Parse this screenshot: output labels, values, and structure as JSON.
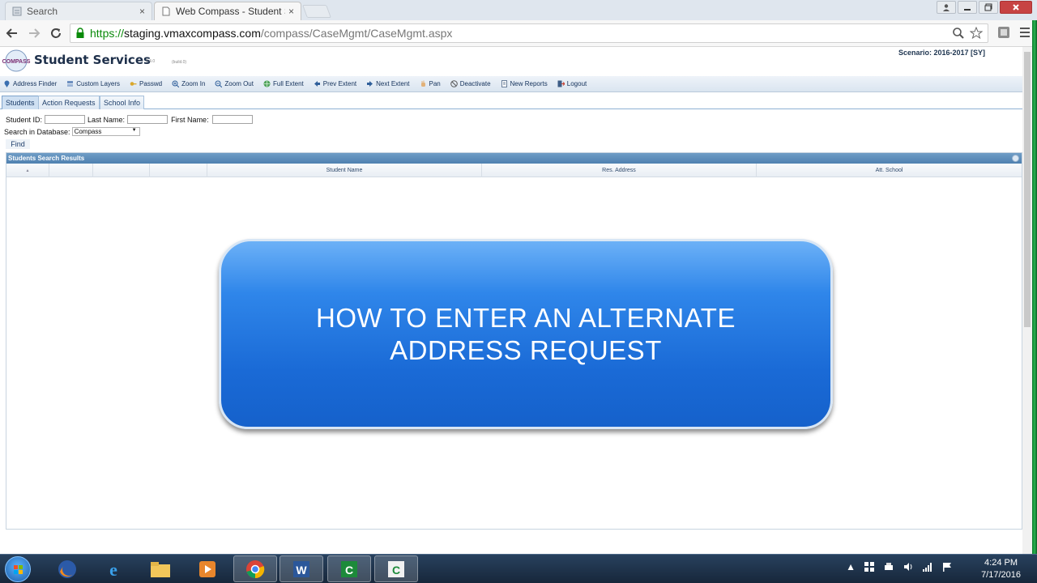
{
  "browser": {
    "tabs": [
      {
        "title": "Search",
        "close": "×"
      },
      {
        "title": "Web Compass - Student S",
        "close": "×"
      }
    ],
    "url": {
      "scheme": "https://",
      "host": "staging.vmaxcompass.com",
      "path": "/compass/CaseMgmt/CaseMgmt.aspx"
    }
  },
  "app": {
    "logo_text": "COMPASS",
    "title": "Student Services",
    "version": "1.4.0",
    "build": "(build.0)",
    "scenario": "Scenario: 2016-2017 [SY]"
  },
  "map_toolbar": [
    {
      "label": "Address Finder",
      "icon": "pin-icon",
      "name": "address-finder-button"
    },
    {
      "label": "Custom Layers",
      "icon": "layers-icon",
      "name": "custom-layers-button"
    },
    {
      "label": "Passwd",
      "icon": "key-icon",
      "name": "passwd-button"
    },
    {
      "label": "Zoom In",
      "icon": "zoom-in-icon",
      "name": "zoom-in-button"
    },
    {
      "label": "Zoom Out",
      "icon": "zoom-out-icon",
      "name": "zoom-out-button"
    },
    {
      "label": "Full Extent",
      "icon": "globe-icon",
      "name": "full-extent-button"
    },
    {
      "label": "Prev Extent",
      "icon": "arrow-left-icon",
      "name": "prev-extent-button"
    },
    {
      "label": "Next Extent",
      "icon": "arrow-right-icon",
      "name": "next-extent-button"
    },
    {
      "label": "Pan",
      "icon": "hand-icon",
      "name": "pan-button"
    },
    {
      "label": "Deactivate",
      "icon": "stop-icon",
      "name": "deactivate-button"
    },
    {
      "label": "New Reports",
      "icon": "report-icon",
      "name": "new-reports-button"
    },
    {
      "label": "Logout",
      "icon": "logout-icon",
      "name": "logout-button"
    }
  ],
  "tabs": [
    "Students",
    "Action Requests",
    "School Info"
  ],
  "search": {
    "student_id_label": "Student ID:",
    "last_name_label": "Last Name:",
    "first_name_label": "First Name:",
    "database_label": "Search in Database:",
    "database_value": "Compass",
    "find_label": "Find"
  },
  "grid": {
    "caption": "Students Search Results",
    "columns": [
      "",
      "",
      "",
      "Student Name",
      "Res. Address",
      "Att. School"
    ]
  },
  "banner": {
    "line1": "HOW TO ENTER AN ALTERNATE",
    "line2": "ADDRESS REQUEST"
  },
  "taskbar": {
    "time": "4:24 PM",
    "date": "7/17/2016"
  },
  "colors": {
    "banner_blue": "#1a6ad6",
    "grid_caption": "#5a89b8",
    "url_green": "#0a8a0a"
  }
}
